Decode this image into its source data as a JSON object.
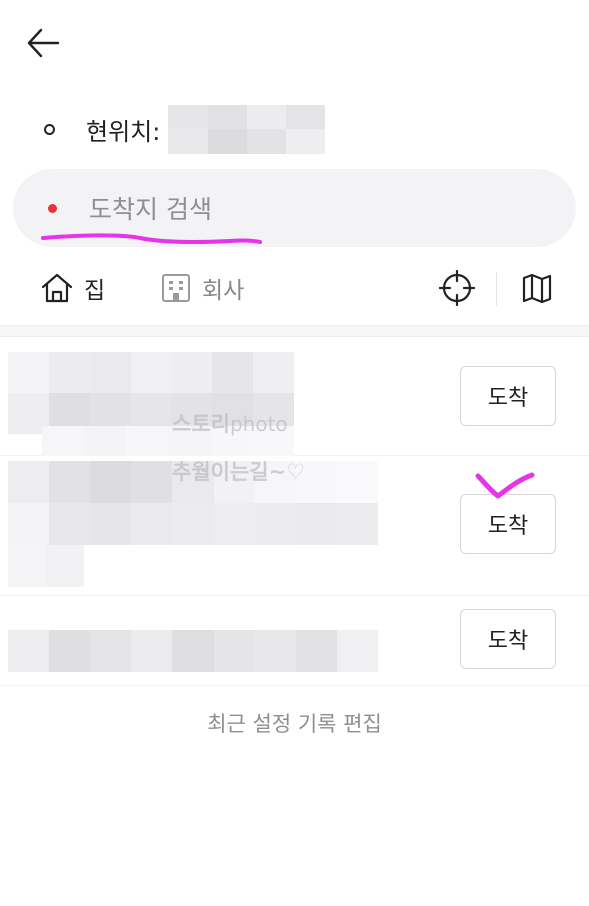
{
  "header": {
    "back_icon": "arrow-left-icon"
  },
  "origin": {
    "label": "현위치:",
    "value_obscured": true
  },
  "destination": {
    "placeholder": "도착지 검색",
    "dot_color": "#e8323c"
  },
  "quick_places": {
    "home": {
      "label": "집",
      "icon": "home-icon"
    },
    "company": {
      "label": "회사",
      "icon": "building-icon"
    },
    "gps_icon": "crosshair-icon",
    "map_icon": "map-icon"
  },
  "history": {
    "items": [
      {
        "action_label": "도착"
      },
      {
        "action_label": "도착"
      },
      {
        "action_label": "도착"
      }
    ],
    "edit_label": "최근 설정 기록 편집"
  },
  "watermark": {
    "line1_main": "스토리",
    "line1_sub": "photo",
    "line2": "추월이는길~♡"
  },
  "colors": {
    "highlight_marker": "#e535e8",
    "text_primary": "#222222",
    "text_secondary": "#8e8e93",
    "search_bg": "#f3f3f5"
  }
}
